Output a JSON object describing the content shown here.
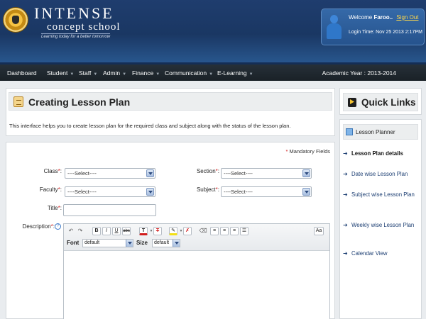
{
  "brand": {
    "title": "INTENSE",
    "subtitle": "concept school",
    "tagline": "Learning today for a better tomorrow"
  },
  "user": {
    "welcome": "Welcome",
    "name": "Faroo..",
    "sign_out": "Sign Out",
    "login_time": "Login Time: Nov 25 2013 2:17PM"
  },
  "nav": {
    "items": [
      {
        "label": "Dashboard",
        "has_menu": false
      },
      {
        "label": "Student",
        "has_menu": true
      },
      {
        "label": "Staff",
        "has_menu": true
      },
      {
        "label": "Admin",
        "has_menu": true
      },
      {
        "label": "Finance",
        "has_menu": true
      },
      {
        "label": "Communication",
        "has_menu": true
      },
      {
        "label": "E-Learning",
        "has_menu": true
      }
    ],
    "academic_year": "Academic Year : 2013-2014"
  },
  "page": {
    "title": "Creating Lesson Plan",
    "description": "This interface helps you to create lesson plan for the required class and subject along with the status of the lesson plan.",
    "mandatory_note": "Mandatory Fields"
  },
  "form": {
    "class_label": "Class",
    "class_value": "----Select----",
    "section_label": "Section",
    "section_value": "----Select----",
    "faculty_label": "Faculty",
    "faculty_value": "----Select----",
    "subject_label": "Subject",
    "subject_value": "----Select----",
    "title_label": "Title",
    "title_value": "",
    "description_label": "Description",
    "req_mark": "*",
    "colon": ":"
  },
  "editor": {
    "undo": "↶",
    "redo": "↷",
    "bold": "B",
    "italic": "I",
    "underline": "U",
    "strike": "abc",
    "text_color": "T",
    "clear_format": "T",
    "aa": "Aa",
    "font_label": "Font",
    "font_value": "default",
    "size_label": "Size",
    "size_value": "default"
  },
  "quick_links": {
    "title": "Quick Links",
    "planner": "Lesson Planner",
    "items": [
      {
        "label": "Lesson Plan details",
        "active": true
      },
      {
        "label": "Date wise Lesson Plan",
        "active": false
      },
      {
        "label": "Subject wise Lesson Plan",
        "active": false
      },
      {
        "label": "Weekly wise Lesson Plan",
        "active": false
      },
      {
        "label": "Calendar View",
        "active": false
      }
    ],
    "bullet": "➜"
  },
  "colors": {
    "header_blue": "#1f3d6e",
    "nav_dark": "#1a2127",
    "signout_yellow": "#ffd84a",
    "required_red": "#d21d1d"
  }
}
